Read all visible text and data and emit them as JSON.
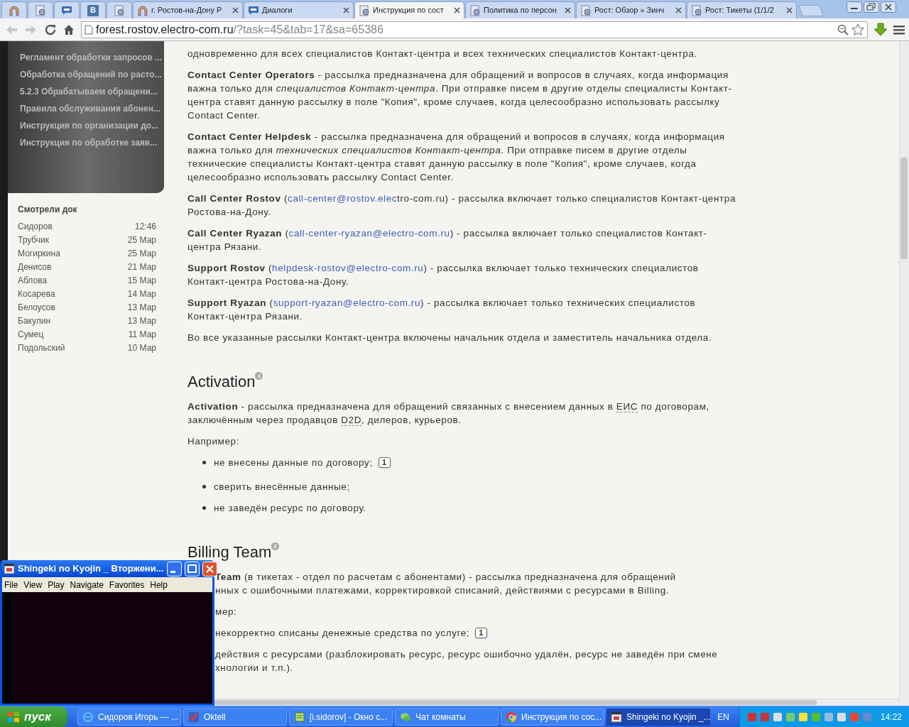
{
  "tabs": [
    {
      "kind": "arch",
      "selected": false
    },
    {
      "kind": "page",
      "selected": false
    },
    {
      "kind": "chat",
      "selected": false
    },
    {
      "kind": "letter",
      "glyph": "В",
      "selected": false
    },
    {
      "kind": "page",
      "selected": false
    },
    {
      "kind": "arch",
      "label": "г. Ростов-на-Дону Р",
      "selected": false
    },
    {
      "kind": "chat",
      "label": "Диалоги",
      "selected": false
    },
    {
      "kind": "page",
      "label": "Инструкция по сост",
      "selected": true
    },
    {
      "kind": "page",
      "label": "Политика по персон",
      "selected": false
    },
    {
      "kind": "page",
      "label": "Рост: Обзор » Зинч",
      "selected": false
    },
    {
      "kind": "page",
      "label": "Рост: Тикеты (1/1/2",
      "selected": false
    }
  ],
  "address": {
    "host": "forest.rostov.electro-com.ru",
    "path": "/?task=45&tab=17&sa=65386"
  },
  "sidebar": {
    "links": [
      "Регламент обработки запросов ...",
      "Обработка обращений по расто...",
      "5.2.3 Обрабатываем обращени...",
      "Правила обслуживания абонен...",
      "Инструкция по организации до...",
      "Инструкция по обработке заяв..."
    ],
    "viewed_title": "Смотрели док",
    "viewed": [
      {
        "name": "Сидоров",
        "date": "12:46"
      },
      {
        "name": "Трубчик",
        "date": "25 Мар"
      },
      {
        "name": "Могиркина",
        "date": "25 Мар"
      },
      {
        "name": "Денисов",
        "date": "21 Мар"
      },
      {
        "name": "Аблова",
        "date": "15 Мар"
      },
      {
        "name": "Косарева",
        "date": "14 Мар"
      },
      {
        "name": "Белоусов",
        "date": "13 Мар"
      },
      {
        "name": "Бакулин",
        "date": "13 Мар"
      },
      {
        "name": "Сумец",
        "date": "11 Мар"
      },
      {
        "name": "Подольский",
        "date": "10 Мар"
      }
    ]
  },
  "content": [
    {
      "kind": "para",
      "segments": [
        {
          "kind": "text",
          "text": "одновременно для всех специалистов Контакт-центра и всех технических специалистов Контакт-центра."
        }
      ]
    },
    {
      "kind": "para",
      "segments": [
        {
          "kind": "text",
          "text": "**Contact Center Operators** - рассылка предназначена для обращений и вопросов в случаях, когда информация важна только для *специалистов Контакт-центра*. При отправке писем в другие отделы специалисты Контакт-центра ставят данную рассылку в поле \"Копия\", кроме случаев, когда целесообразно использовать рассылку Contact Center."
        }
      ]
    },
    {
      "kind": "para",
      "segments": [
        {
          "kind": "text",
          "text": "**Contact Center Helpdesk** - рассылка предназначена для обращений и вопросов в случаях, когда информация важна только для *технических специалистов Контакт-центра*. При отправке писем в другие отделы технические специалисты Контакт-центра ставят данную рассылку в поле \"Копия\", кроме случаев, когда целесообразно использовать рассылку Contact Center."
        }
      ]
    },
    {
      "kind": "para",
      "segments": [
        {
          "kind": "text",
          "text": "**Call Center Rostov** ("
        },
        {
          "kind": "link",
          "text": "call-center@rostov.elec"
        },
        {
          "kind": "text",
          "text": "tro-com.ru) - рассылка включает только специалистов Контакт-центра Ростова-на-Дону."
        }
      ]
    },
    {
      "kind": "para",
      "segments": [
        {
          "kind": "text",
          "text": "**Call Center Ryazan** ("
        },
        {
          "kind": "link",
          "text": "call-center-ryazan@electro-com.ru"
        },
        {
          "kind": "text",
          "text": ") - рассылка включает только специалистов Контакт-центра Рязани."
        }
      ]
    },
    {
      "kind": "para",
      "segments": [
        {
          "kind": "text",
          "text": "**Support Rostov** ("
        },
        {
          "kind": "link",
          "text": "helpdesk-rostov@electro-com.ru"
        },
        {
          "kind": "text",
          "text": ") - рассылка включает только технических специалистов Контакт-центра Ростова-на-Дону."
        }
      ]
    },
    {
      "kind": "para",
      "segments": [
        {
          "kind": "text",
          "text": "**Support Ryazan** ("
        },
        {
          "kind": "link",
          "text": "support-ryazan@electro-com.ru"
        },
        {
          "kind": "text",
          "text": ") - рассылка включает только технических специалистов Контакт-центра Рязани."
        }
      ]
    },
    {
      "kind": "para",
      "segments": [
        {
          "kind": "text",
          "text": "Во все указанные рассылки Контакт-центра включены начальник отдела и заместитель начальника отдела."
        }
      ]
    },
    {
      "kind": "heading",
      "title": "Activation",
      "note": "1"
    },
    {
      "kind": "para",
      "segments": [
        {
          "kind": "text",
          "text": "**Activation** - рассылка предназначена для обращений связанных с внесением данных в "
        },
        {
          "kind": "abbr",
          "text": "ЕИС"
        },
        {
          "kind": "text",
          "text": " по договорам, заключённым через продавцов "
        },
        {
          "kind": "abbr",
          "text": "D2D"
        },
        {
          "kind": "text",
          "text": ", дилеров, курьеров."
        }
      ]
    },
    {
      "kind": "para",
      "segments": [
        {
          "kind": "text",
          "text": "Например:"
        }
      ]
    },
    {
      "kind": "bullet",
      "text": "не внесены данные по договору;",
      "comments": "1"
    },
    {
      "kind": "bullet",
      "text": "сверить внесённые данные;"
    },
    {
      "kind": "bullet",
      "text": "не заведён ресурс по договору."
    },
    {
      "kind": "heading",
      "title": "Billing Team",
      "note": "2"
    },
    {
      "kind": "fragment",
      "text": "**Team** (в тикетах - отдел по расчетам с абонентами) - рассылка предназначена для обращений"
    },
    {
      "kind": "fragment_line",
      "text": "нных с ошибочными платежами, корректировкой списаний, действиями с ресурсами в Billing."
    },
    {
      "kind": "fragment",
      "text": "мер:"
    },
    {
      "kind": "fragment",
      "text": "некорректно списаны денежные средства по услуге;",
      "comments": "1"
    },
    {
      "kind": "fragment",
      "text": "действия с ресурсами (разблокировать ресурс, ресурс ошибочно удалён, ресурс не заведён при смене"
    },
    {
      "kind": "fragment_line",
      "text": "хнологии и т.п.)."
    }
  ],
  "player": {
    "title": "Shingeki no Kyojin _ Вторжени...",
    "menu": [
      "File",
      "View",
      "Play",
      "Navigate",
      "Favorites",
      "Help"
    ]
  },
  "taskbar": {
    "start": "пуск",
    "items": [
      {
        "kind": "ie",
        "label": "Сидоров Игорь — ...",
        "selected": false
      },
      {
        "kind": "check",
        "label": "Oktell",
        "selected": false
      },
      {
        "kind": "note",
        "label": "[i.sidorov] - Окно с...",
        "selected": false
      },
      {
        "kind": "chat",
        "label": "Чат комнаты",
        "selected": false
      },
      {
        "kind": "chrome",
        "label": "Инструкция по сос...",
        "selected": false
      },
      {
        "kind": "film",
        "label": "Shingeki no Kyojin _...",
        "selected": true
      }
    ],
    "language": "EN",
    "clock": "14:22"
  }
}
